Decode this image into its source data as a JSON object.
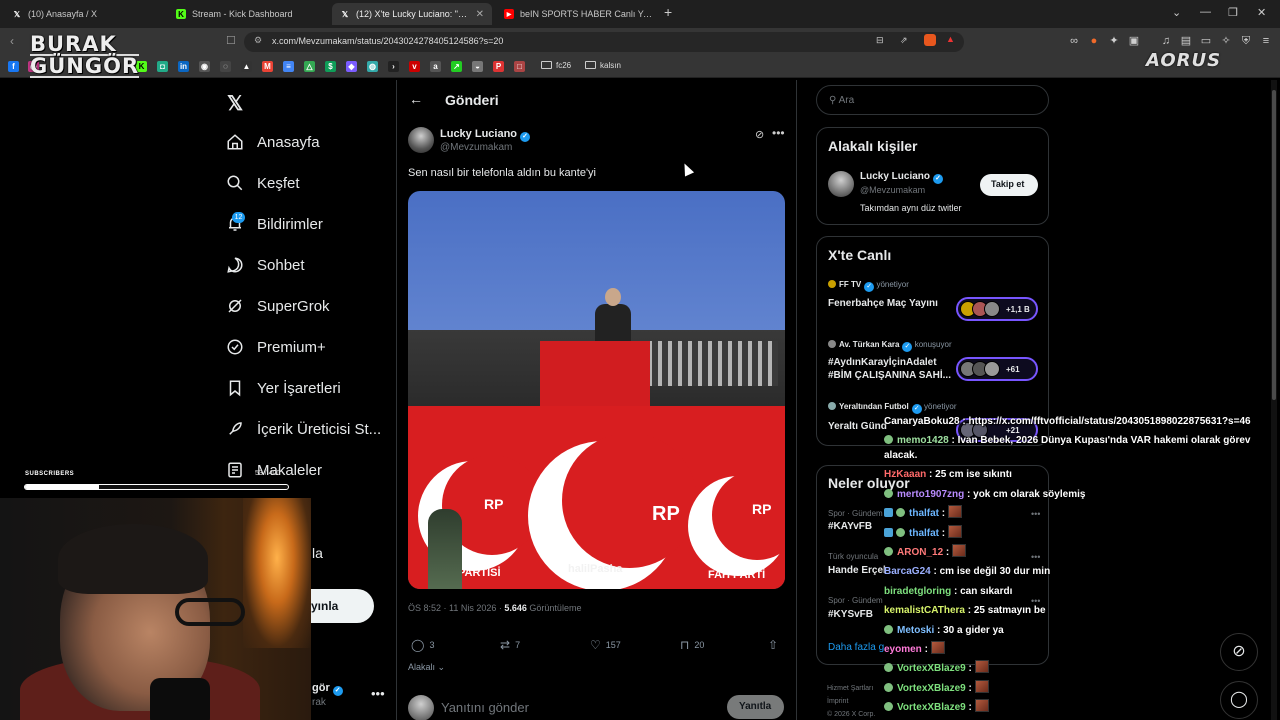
{
  "browser": {
    "tabs": [
      {
        "title": "(10) Anasayfa / X",
        "icon": "x-logo",
        "active": false
      },
      {
        "title": "Stream - Kick Dashboard",
        "icon": "kick-logo",
        "active": false
      },
      {
        "title": "(12) X'te Lucky Luciano: \"Sen",
        "icon": "x-logo",
        "active": true
      },
      {
        "title": "beIN SPORTS HABER Canlı Yayını | B",
        "icon": "youtube-logo",
        "active": false
      }
    ],
    "url": "x.com/Mevzumakam/status/2043024278405124586?s=20",
    "bookmark_folders": [
      "fc26",
      "kalsın"
    ]
  },
  "overlay": {
    "logo_top": "BURAK",
    "logo_bottom": "GÜNGÖR",
    "brand": "AORUS",
    "subscribers_label": "SUBSCRIBERS",
    "subscribers_count": "53 / 400",
    "subscribers_progress": 0.28
  },
  "nav": {
    "items": [
      {
        "label": "Anasayfa",
        "icon": "home-icon"
      },
      {
        "label": "Keşfet",
        "icon": "search-icon"
      },
      {
        "label": "Bildirimler",
        "icon": "bell-icon"
      },
      {
        "label": "Sohbet",
        "icon": "chat-icon"
      },
      {
        "label": "SuperGrok",
        "icon": "grok-icon"
      },
      {
        "label": "Premium+",
        "icon": "premium-icon"
      },
      {
        "label": "Yer İşaretleri",
        "icon": "bookmark-icon"
      },
      {
        "label": "İçerik Üreticisi St...",
        "icon": "rocket-icon"
      },
      {
        "label": "Makaleler",
        "icon": "article-icon"
      }
    ],
    "notification_count": "12",
    "partial_item": "la",
    "post_button": "yınla",
    "profile_name": "gör",
    "profile_handle": "rak"
  },
  "post": {
    "header": "Gönderi",
    "author_name": "Lucky Luciano",
    "author_handle": "@Mevzumakam",
    "text": "Sen nasıl bir telefonla aldın bu kante'yi",
    "media_watermark": "halilPasha",
    "media_texts": {
      "rp": "RP",
      "partisi": "PARTİSİ",
      "refah": "FAH PARTİ"
    },
    "time": "ÖS 8:52 · 11 Nis 2026 · ",
    "views_count": "5.646",
    "views_label": " Görüntüleme",
    "actions": {
      "replies": "3",
      "reposts": "7",
      "likes": "157",
      "bookmarks": "20"
    },
    "sort_label": "Alakalı",
    "reply_placeholder": "Yanıtını gönder",
    "reply_button": "Yanıtla"
  },
  "sidebar": {
    "search_placeholder": "Ara",
    "relevant": {
      "title": "Alakalı kişiler",
      "name": "Lucky Luciano",
      "handle": "@Mevzumakam",
      "bio": "Takımdan aynı düz twitler",
      "follow": "Takip et"
    },
    "live": {
      "title": "X'te Canlı",
      "items": [
        {
          "host": "FF TV",
          "role": "yönetiyor",
          "title_lines": [
            "Fenerbahçe Maç Yayını"
          ],
          "count": "+1,1 B"
        },
        {
          "host": "Av. Türkan Kara",
          "role": "konuşuyor",
          "title_lines": [
            "#AydınKarayİçinAdalet",
            "#BİM ÇALIŞANINA SAHİ..."
          ],
          "count": "+61"
        },
        {
          "host": "Yeraltından Futbol",
          "role": "yönetiyor",
          "title_lines": [
            "Yeraltı Günd"
          ],
          "count": "+21"
        }
      ]
    },
    "trends": {
      "title": "Neler oluyor",
      "items": [
        {
          "category": "Spor · Gündem",
          "tag": "#KAYvFB"
        },
        {
          "category": "Türk oyuncula",
          "tag": "Hande Erçel"
        },
        {
          "category": "Spor · Gündem",
          "tag": "#KYSvFB"
        }
      ],
      "show_more": "Daha fazla g"
    },
    "footer": [
      "Hizmet Şartları",
      "İmprint",
      "© 2026 X Corp."
    ]
  },
  "chat": [
    {
      "user": "CanaryaBoku28",
      "message": "https://x.com/fftvofficial/status/2043051898022875631?s=46",
      "color": "#ffffff"
    },
    {
      "user": "memo1428",
      "message": "Ivan Bebek, 2026 Dünya Kupası'nda VAR hakemi olarak görev alacak.",
      "color": "#9ee0a0"
    },
    {
      "user": "HzKaaan",
      "message": "25 cm ise sıkıntı",
      "color": "#ff6a6a"
    },
    {
      "user": "merto1907zng",
      "message": "yok cm olarak söylemiş",
      "color": "#b98cff"
    },
    {
      "user": "thalfat",
      "message": "",
      "color": "#6cb6ff"
    },
    {
      "user": "thalfat",
      "message": "",
      "color": "#6cb6ff"
    },
    {
      "user": "ARON_12",
      "message": "",
      "color": "#ff7a7a"
    },
    {
      "user": "BarcaG24",
      "message": "cm ise değil 30 dur min",
      "color": "#9bb0ff"
    },
    {
      "user": "biradetgloring",
      "message": "can sıkardı",
      "color": "#7ee07e"
    },
    {
      "user": "kemalistCAThera",
      "message": "25 satmayın be",
      "color": "#d7f36b"
    },
    {
      "user": "Metoski",
      "message": "30 a gider ya",
      "color": "#7fbfff"
    },
    {
      "user": "eyomen",
      "message": "",
      "color": "#ff7ad9"
    },
    {
      "user": "VortexXBlaze9",
      "message": "",
      "color": "#7ee07e"
    },
    {
      "user": "VortexXBlaze9",
      "message": "",
      "color": "#7ee07e"
    },
    {
      "user": "VortexXBlaze9",
      "message": "",
      "color": "#7ee07e"
    }
  ]
}
